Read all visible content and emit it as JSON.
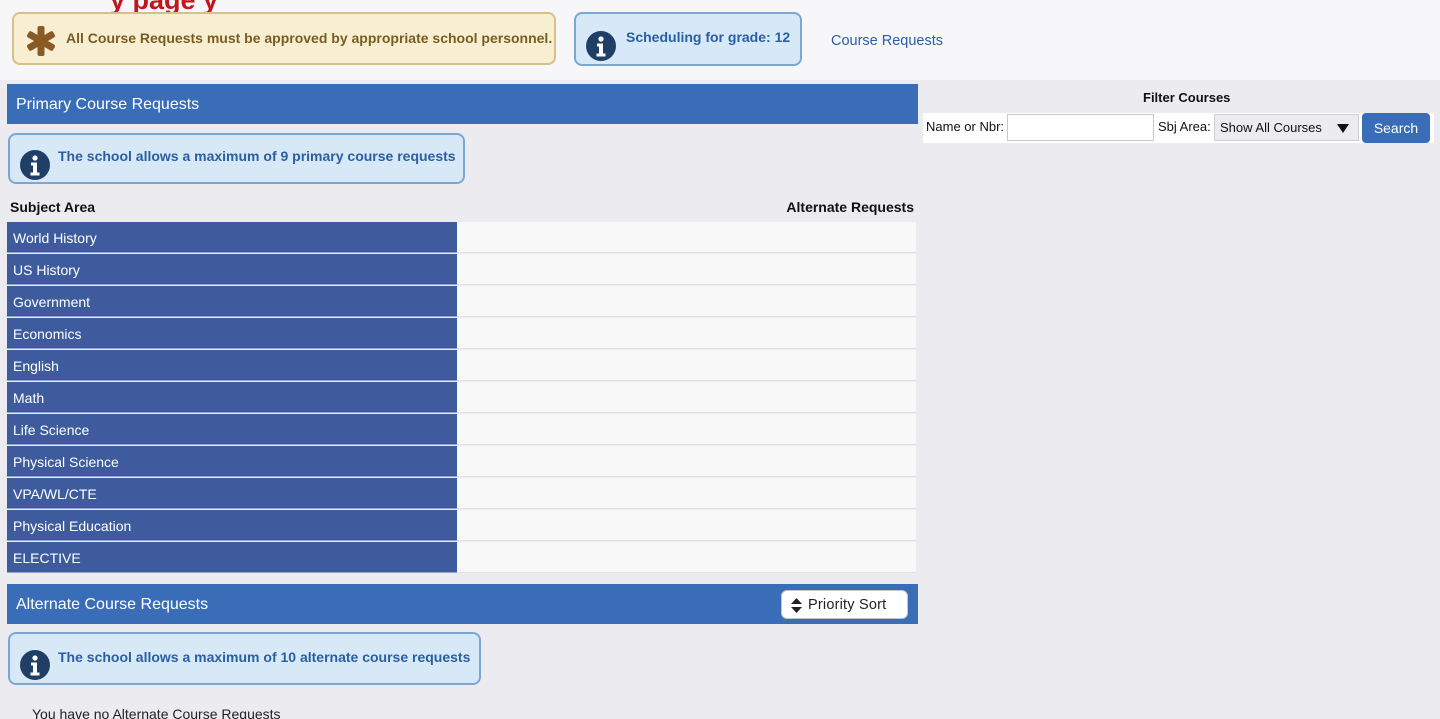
{
  "banner": {
    "cut_heading": "y               page     y",
    "warning_text": "All Course Requests must be approved by appropriate school personnel.",
    "grade_text": "Scheduling for grade: 12",
    "course_requests_link": "Course Requests"
  },
  "primary": {
    "header": "Primary Course Requests",
    "max_notice": "The school allows a maximum of 9 primary course requests",
    "col_subject": "Subject Area",
    "col_alternate": "Alternate Requests",
    "subjects": [
      "World History",
      "US History",
      "Government",
      "Economics",
      "English",
      "Math",
      "Life Science",
      "Physical Science",
      "VPA/WL/CTE",
      "Physical Education",
      "ELECTIVE"
    ]
  },
  "alternate": {
    "header": "Alternate Course Requests",
    "priority_sort_label": "Priority Sort",
    "max_notice": "The school allows a maximum of 10 alternate course requests",
    "empty_text": "You have no Alternate Course Requests"
  },
  "filter": {
    "title": "Filter Courses",
    "name_label": "Name or Nbr:",
    "name_value": "",
    "sbj_label": "Sbj Area:",
    "sbj_selected": "Show All Courses",
    "search_label": "Search"
  },
  "colors": {
    "header_blue": "#3a6db8",
    "subject_cell": "#3e5c9d",
    "info_bg": "#d7e8f6",
    "warning_bg": "#f8efd3",
    "heading_red": "#c0171c"
  }
}
